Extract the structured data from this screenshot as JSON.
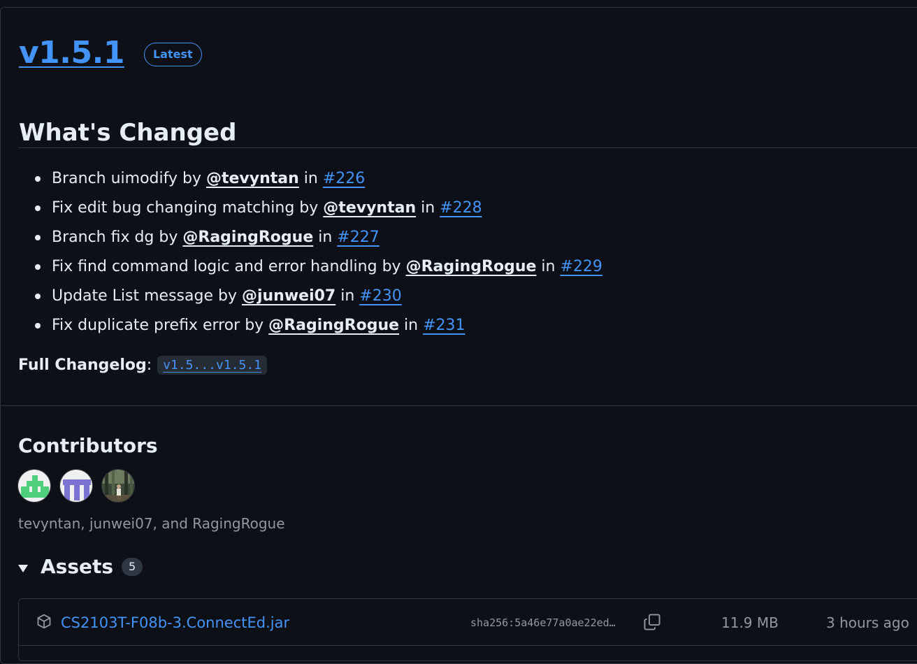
{
  "release": {
    "version": "v1.5.1",
    "latest_label": "Latest",
    "heading": "What's Changed",
    "changes": [
      {
        "text": "Branch uimodify by ",
        "user": "@tevyntan",
        "sep": " in ",
        "pr": "#226"
      },
      {
        "text": "Fix edit bug changing matching by ",
        "user": "@tevyntan",
        "sep": " in ",
        "pr": "#228"
      },
      {
        "text": "Branch fix dg by ",
        "user": "@RagingRogue",
        "sep": " in ",
        "pr": "#227"
      },
      {
        "text": "Fix find command logic and error handling by ",
        "user": "@RagingRogue",
        "sep": " in ",
        "pr": "#229"
      },
      {
        "text": "Update List message by ",
        "user": "@junwei07",
        "sep": " in ",
        "pr": "#230"
      },
      {
        "text": "Fix duplicate prefix error by ",
        "user": "@RagingRogue",
        "sep": " in ",
        "pr": "#231"
      }
    ],
    "full_changelog_label": "Full Changelog",
    "full_changelog_colon": ":",
    "full_changelog_link": "v1.5...v1.5.1"
  },
  "contributors": {
    "heading": "Contributors",
    "avatars": [
      "tevyntan",
      "junwei07",
      "RagingRogue"
    ],
    "names_text": "tevyntan, junwei07, and RagingRogue"
  },
  "assets": {
    "heading": "Assets",
    "count": "5",
    "items": [
      {
        "name": "CS2103T-F08b-3.ConnectEd.jar",
        "sha": "sha256:5a46e77a0ae22ed…",
        "size": "11.9 MB",
        "time": "3 hours ago"
      }
    ]
  },
  "colors": {
    "background": "#0d1117",
    "text": "#e6edf3",
    "link": "#4493f8",
    "muted": "#9198a1",
    "border": "#30363d"
  },
  "icons": [
    "package-icon",
    "copy-icon",
    "caret-down-icon"
  ]
}
